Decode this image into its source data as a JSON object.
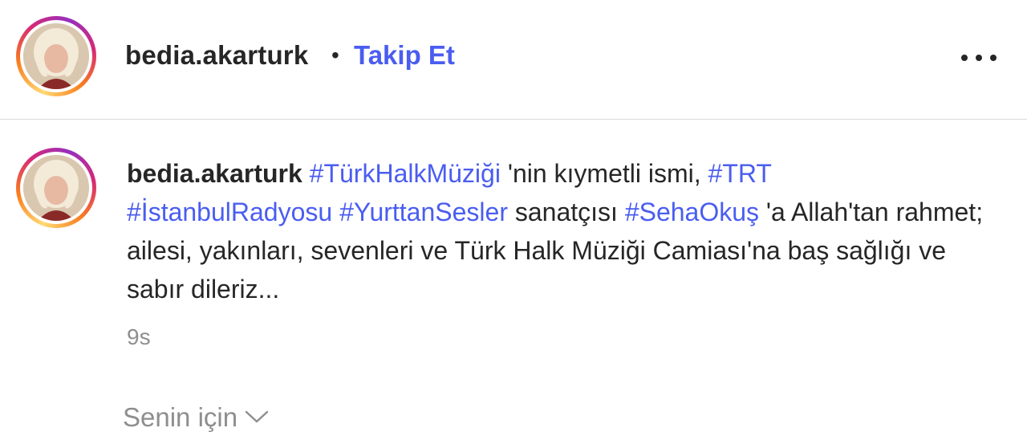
{
  "header": {
    "username": "bedia.akarturk",
    "separator": "•",
    "follow_label": "Takip Et",
    "more_icon": "more-horizontal-icon"
  },
  "comment": {
    "username": "bedia.akarturk",
    "segments": [
      {
        "type": "tag",
        "text": "#TürkHalkMüziği"
      },
      {
        "type": "text",
        "text": " 'nin kıymetli ismi, "
      },
      {
        "type": "tag",
        "text": "#TRT"
      },
      {
        "type": "text",
        "text": " "
      },
      {
        "type": "tag",
        "text": "#İstanbulRadyosu"
      },
      {
        "type": "text",
        "text": " "
      },
      {
        "type": "tag",
        "text": "#YurttanSesler"
      },
      {
        "type": "text",
        "text": " sanatçısı "
      },
      {
        "type": "tag",
        "text": "#SehaOkuş"
      },
      {
        "type": "text",
        "text": " 'a Allah'tan rahmet; ailesi, yakınları, sevenleri ve Türk Halk Müziği Camiası'na baş sağlığı ve sabır dileriz..."
      }
    ],
    "time": "9s"
  },
  "footer": {
    "for_you_label": "Senin için",
    "chevron_icon": "chevron-down-icon"
  },
  "colors": {
    "link": "#4a5df0",
    "text": "#262626",
    "muted": "#8e8e8e",
    "divider": "#dbdbdb"
  }
}
